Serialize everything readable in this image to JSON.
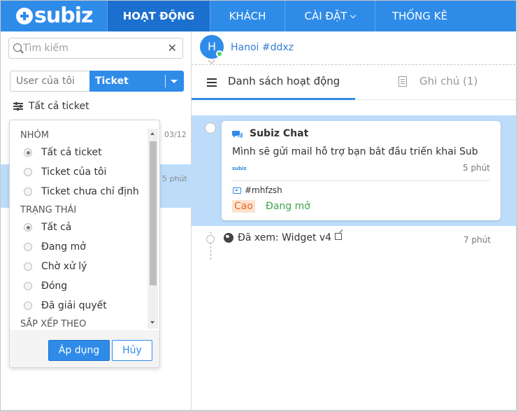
{
  "nav": {
    "logo": "subiz",
    "items": [
      {
        "label": "HOẠT ĐỘNG",
        "active": true
      },
      {
        "label": "KHÁCH",
        "active": false
      },
      {
        "label": "CÀI ĐẶT",
        "active": false,
        "has_caret": true
      },
      {
        "label": "THỐNG KÊ",
        "active": false
      }
    ],
    "accent": "#2f8be8",
    "active_bg": "#1b6fcf"
  },
  "sidebar": {
    "search_placeholder": "Tìm kiếm",
    "segment_left": "User của tôi",
    "segment_right": "Ticket",
    "filter_label": "Tất cả ticket",
    "conversations": [
      {
        "time": "03/12"
      },
      {
        "time": "5 phút"
      }
    ]
  },
  "filter_dropdown": {
    "group_heading": "NHÓM",
    "group_options": [
      {
        "label": "Tất cả ticket",
        "selected": true
      },
      {
        "label": "Ticket của tôi",
        "selected": false
      },
      {
        "label": "Ticket chưa chỉ định",
        "selected": false
      }
    ],
    "status_heading": "TRẠNG THÁI",
    "status_options": [
      {
        "label": "Tất cả",
        "selected": true
      },
      {
        "label": "Đang mở",
        "selected": false
      },
      {
        "label": "Chờ xử lý",
        "selected": false
      },
      {
        "label": "Đóng",
        "selected": false
      },
      {
        "label": "Đã giải quyết",
        "selected": false
      }
    ],
    "sort_heading": "SẮP XẾP THEO",
    "apply_label": "Áp dụng",
    "cancel_label": "Hủy"
  },
  "conversation": {
    "avatar_letter": "H",
    "name": "Hanoi #ddxz",
    "tabs": [
      {
        "label": "Danh sách hoạt động",
        "active": true
      },
      {
        "label": "Ghi chú (1)",
        "active": false
      }
    ],
    "message_card": {
      "title": "Subiz Chat",
      "message": "Mình sẽ gửi mail hỗ trợ bạn bắt đầu triển khai Sub",
      "brand": "subiz",
      "time": "5 phút",
      "ticket_id": "#mhfzsh",
      "priority": "Cao",
      "status": "Đang mở",
      "priority_color": "#e8681f",
      "status_color": "#3fa44a"
    },
    "event": {
      "text": "Đã xem: Widget v4",
      "time": "7 phút"
    }
  }
}
